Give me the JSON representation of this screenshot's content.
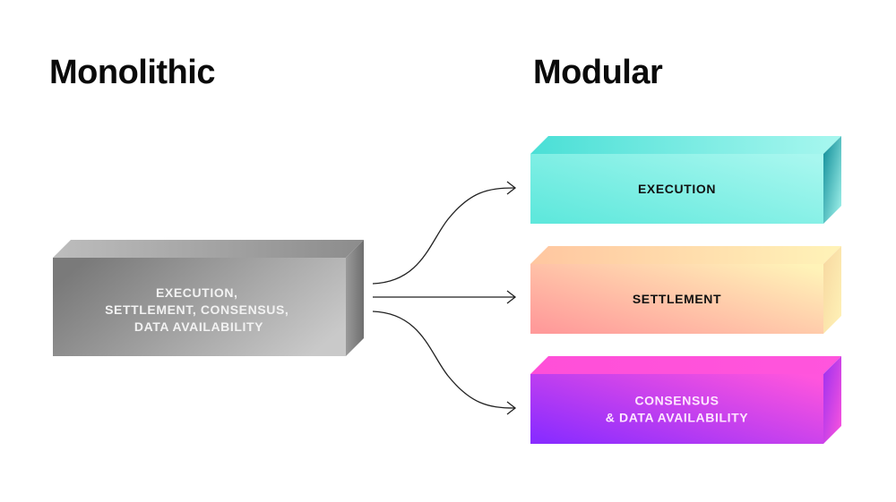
{
  "titles": {
    "left": "Monolithic",
    "right": "Modular"
  },
  "monolithic_block": {
    "lines": [
      "EXECUTION,",
      "SETTLEMENT, CONSENSUS,",
      "DATA AVAILABILITY"
    ],
    "text_color": "#f2f2f2",
    "colors": {
      "front_start": "#7a7a7a",
      "front_end": "#c9c9c9",
      "top": "#a8a8a8",
      "side": "#8a8a8a"
    }
  },
  "modular_blocks": [
    {
      "id": "execution",
      "lines": [
        "EXECUTION"
      ],
      "text_color": "#111111",
      "colors": {
        "front_start": "#5fe8dc",
        "front_end": "#a8f7ef",
        "top": "#4adfd6",
        "side": "#0a8a96"
      }
    },
    {
      "id": "settlement",
      "lines": [
        "SETTLEMENT"
      ],
      "text_color": "#111111",
      "colors": {
        "front_start": "#ff9a9a",
        "front_end": "#fff3b8",
        "top": "#ffc6a0",
        "side": "#f7d7a0"
      }
    },
    {
      "id": "consensus-da",
      "lines": [
        "CONSENSUS",
        "& DATA AVAILABILITY"
      ],
      "text_color": "#ffe6ff",
      "colors": {
        "front_start": "#8a2cff",
        "front_end": "#ff55dd",
        "top": "#ff4fd8",
        "side": "#9a30f0"
      }
    }
  ],
  "arrows": {
    "color": "#222222",
    "count": 3
  }
}
